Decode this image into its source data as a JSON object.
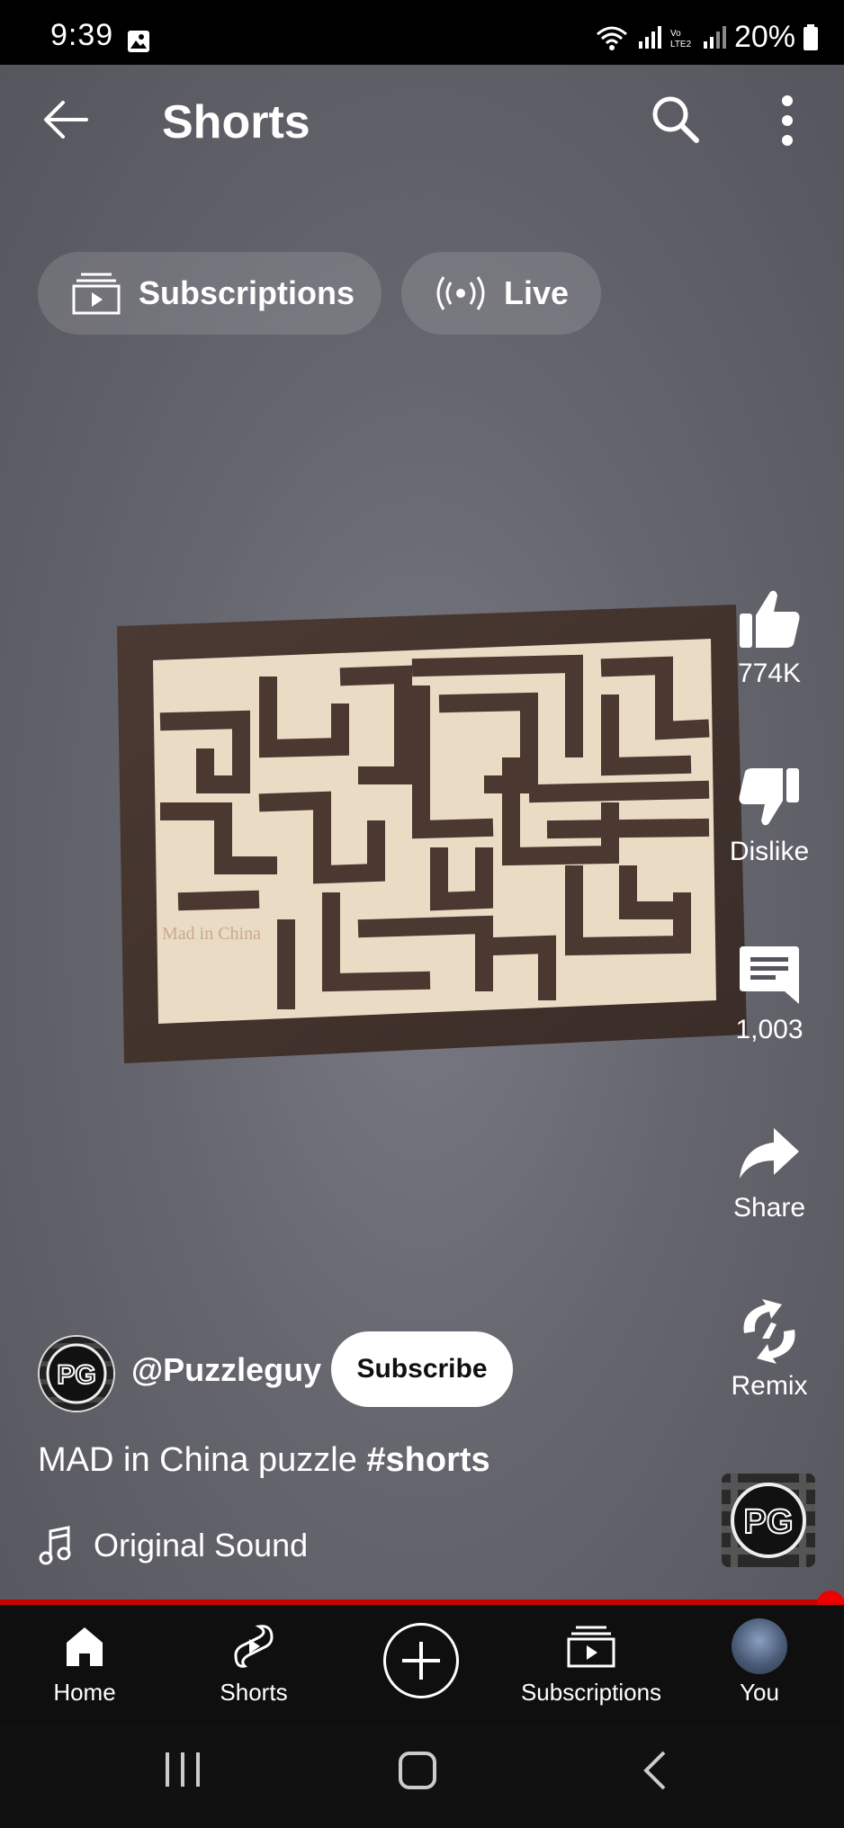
{
  "status_bar": {
    "time": "9:39",
    "battery": "20%"
  },
  "header": {
    "title": "Shorts"
  },
  "chips": [
    {
      "label": "Subscriptions",
      "icon": "subscriptions-icon"
    },
    {
      "label": "Live",
      "icon": "live-icon"
    }
  ],
  "video": {
    "board_text": "Mad in China"
  },
  "actions": {
    "like": "774K",
    "dislike": "Dislike",
    "comments": "1,003",
    "share": "Share",
    "remix": "Remix"
  },
  "channel": {
    "handle": "@Puzzleguy",
    "subscribe_label": "Subscribe",
    "avatar_text": "PG"
  },
  "caption": {
    "text": "MAD in China puzzle ",
    "hashtag": "#shorts"
  },
  "sound": {
    "label": "Original Sound"
  },
  "bottom_nav": {
    "home": "Home",
    "shorts": "Shorts",
    "subscriptions": "Subscriptions",
    "you": "You"
  },
  "colors": {
    "progress": "#cc0000",
    "nav_bg": "#0f0f0f",
    "video_bg": "#66666f"
  }
}
